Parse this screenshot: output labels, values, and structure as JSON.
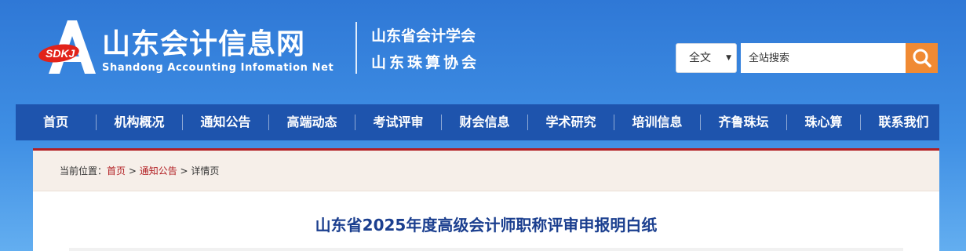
{
  "header": {
    "logo_text": "SDKJ",
    "site_title": "山东会计信息网",
    "site_subtitle": "Shandong Accounting Infomation Net",
    "org_line_1": "山东省会计学会",
    "org_line_2": "山东珠算协会"
  },
  "search": {
    "scope_value": "全文",
    "scope_arrow": "▼",
    "placeholder": "全站搜索",
    "button_icon": "search-icon",
    "button_color": "#f08a33"
  },
  "nav": {
    "items": [
      {
        "label": "首页"
      },
      {
        "label": "机构概况"
      },
      {
        "label": "通知公告"
      },
      {
        "label": "高端动态"
      },
      {
        "label": "考试评审"
      },
      {
        "label": "财会信息"
      },
      {
        "label": "学术研究"
      },
      {
        "label": "培训信息"
      },
      {
        "label": "齐鲁珠坛"
      },
      {
        "label": "珠心算"
      },
      {
        "label": "联系我们"
      }
    ]
  },
  "breadcrumb": {
    "prefix": "当前位置：",
    "home": "首页",
    "sep1": " > ",
    "section": "通知公告",
    "sep2": " > ",
    "current": "详情页"
  },
  "article": {
    "title": "山东省2025年度高级会计师职称评审申报明白纸"
  },
  "colors": {
    "nav_bg": "#1e54ad",
    "accent_red": "#b21f23",
    "title_blue": "#1b3f8f"
  }
}
